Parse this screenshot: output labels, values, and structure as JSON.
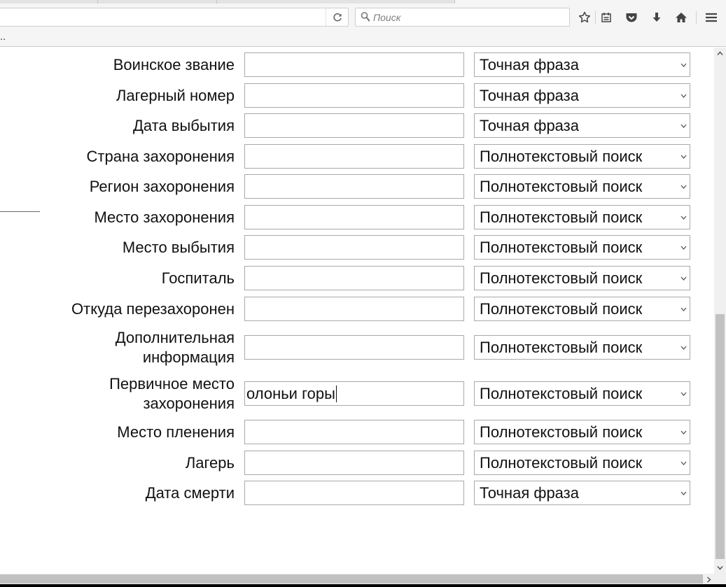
{
  "browser": {
    "search_placeholder": "Поиск",
    "bookmarks_overflow": "..",
    "icons": [
      "reload-icon",
      "search-icon",
      "bookmark-star-icon",
      "reading-list-icon",
      "pocket-icon",
      "downloads-icon",
      "home-icon",
      "menu-icon"
    ]
  },
  "form": {
    "rows": [
      {
        "label": "Воинское звание",
        "value": "",
        "mode": "Точная фраза"
      },
      {
        "label": "Лагерный номер",
        "value": "",
        "mode": "Точная фраза"
      },
      {
        "label": "Дата выбытия",
        "value": "",
        "mode": "Точная фраза"
      },
      {
        "label": "Страна захоронения",
        "value": "",
        "mode": "Полнотекстовый поиск"
      },
      {
        "label": "Регион захоронения",
        "value": "",
        "mode": "Полнотекстовый поиск"
      },
      {
        "label": "Место захоронения",
        "value": "",
        "mode": "Полнотекстовый поиск"
      },
      {
        "label": "Место выбытия",
        "value": "",
        "mode": "Полнотекстовый поиск"
      },
      {
        "label": "Госпиталь",
        "value": "",
        "mode": "Полнотекстовый поиск"
      },
      {
        "label": "Откуда перезахоронен",
        "value": "",
        "mode": "Полнотекстовый поиск"
      },
      {
        "label_line1": "Дополнительная",
        "label_line2": "информация",
        "value": "",
        "mode": "Полнотекстовый поиск"
      },
      {
        "label_line1": "Первичное место",
        "label_line2": "захоронения",
        "value": "олоньи горы",
        "mode": "Полнотекстовый поиск"
      },
      {
        "label": "Место пленения",
        "value": "",
        "mode": "Полнотекстовый поиск"
      },
      {
        "label": "Лагерь",
        "value": "",
        "mode": "Полнотекстовый поиск"
      },
      {
        "label": "Дата смерти",
        "value": "",
        "mode": "Точная фраза"
      }
    ]
  },
  "colors": {
    "chrome": "#f5f5f5",
    "field_border": "#a9a9a9",
    "link_line": "#2a7fa0",
    "scroll_thumb": "#c1c1c1"
  }
}
